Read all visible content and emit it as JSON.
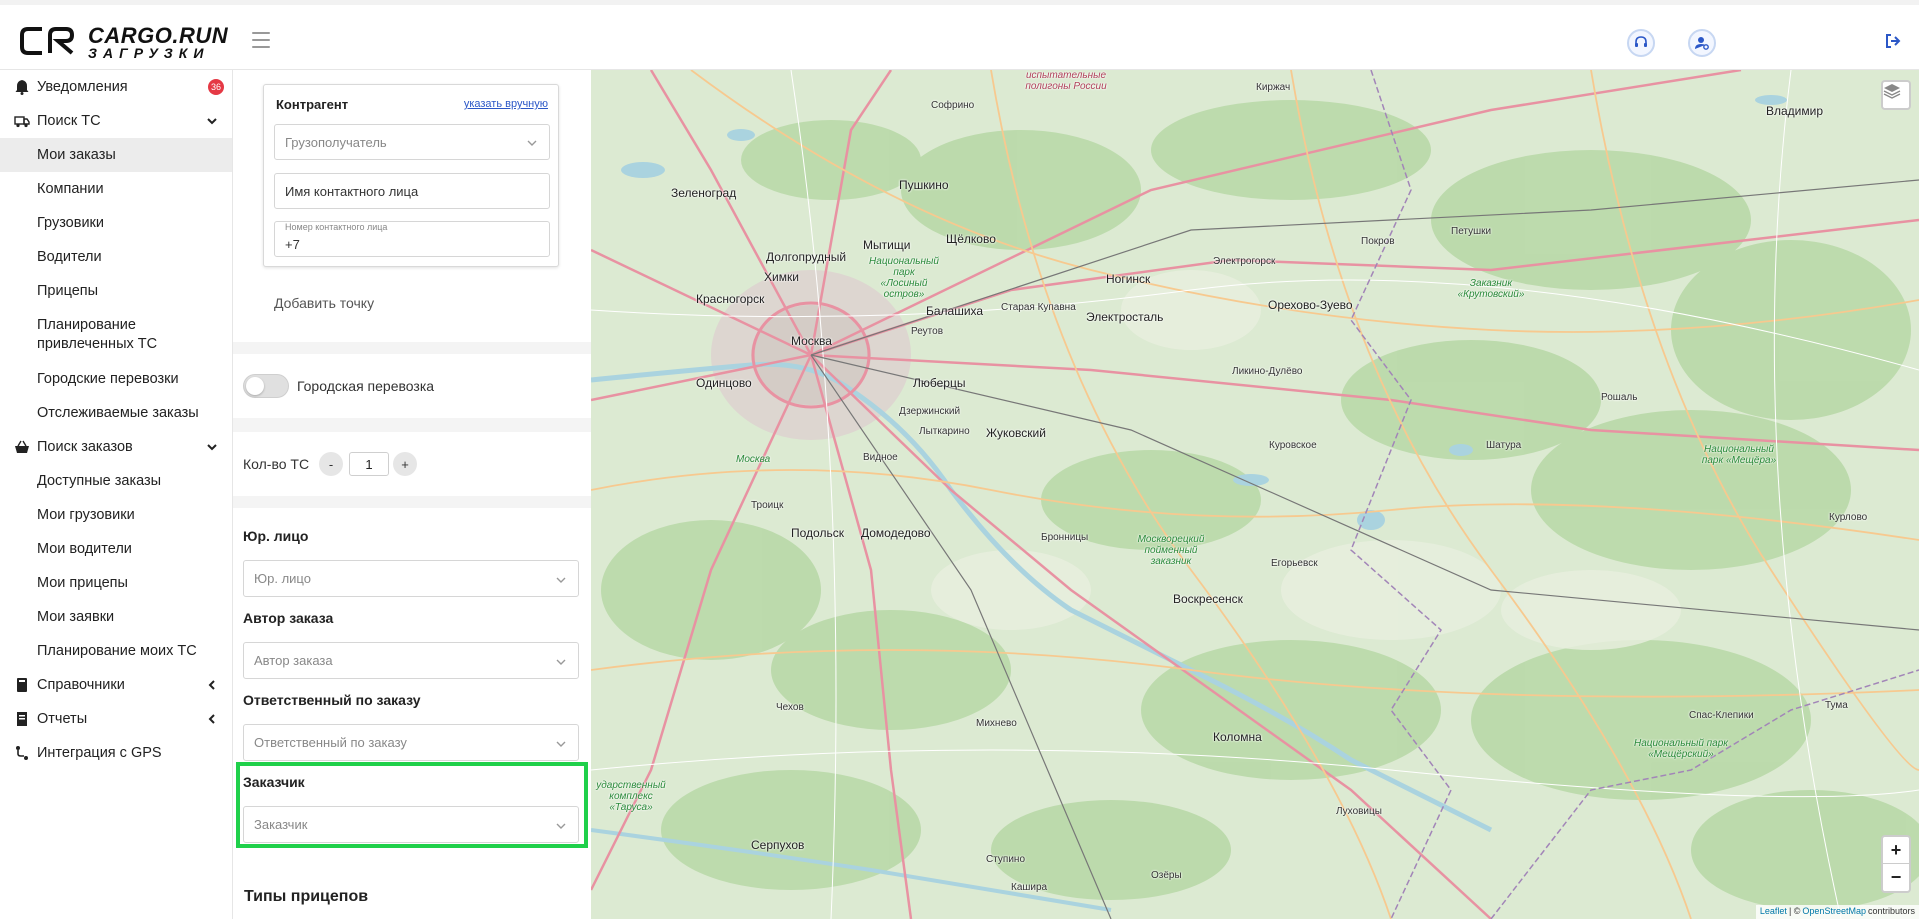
{
  "header": {
    "logo_line1": "CARGO.RUN",
    "logo_line2": "ЗАГРУЗКИ"
  },
  "sidebar": {
    "items": [
      {
        "label": "Уведомления",
        "icon": "bell-icon",
        "badge": "36"
      },
      {
        "label": "Поиск ТС",
        "icon": "truck-icon",
        "chevron": "down"
      },
      {
        "label": "Мои заказы",
        "active": true
      },
      {
        "label": "Компании"
      },
      {
        "label": "Грузовики"
      },
      {
        "label": "Водители"
      },
      {
        "label": "Прицепы"
      },
      {
        "label": "Планирование привлеченных ТС"
      },
      {
        "label": "Городские перевозки"
      },
      {
        "label": "Отслеживаемые заказы"
      },
      {
        "label": "Поиск заказов",
        "icon": "basket-icon",
        "chevron": "down"
      },
      {
        "label": "Доступные заказы"
      },
      {
        "label": "Мои грузовики"
      },
      {
        "label": "Мои водители"
      },
      {
        "label": "Мои прицепы"
      },
      {
        "label": "Мои заявки"
      },
      {
        "label": "Планирование моих ТС"
      },
      {
        "label": "Справочники",
        "icon": "book-icon",
        "chevron": "left"
      },
      {
        "label": "Отчеты",
        "icon": "report-icon",
        "chevron": "left"
      },
      {
        "label": "Интеграция с GPS",
        "icon": "gps-icon"
      }
    ]
  },
  "form": {
    "kontragent": {
      "title": "Контрагент",
      "link": "указать вручную",
      "type_placeholder": "Грузополучатель",
      "contact_name_placeholder": "Имя контактного лица",
      "contact_phone_label": "Номер контактного лица",
      "contact_phone_value": "+7"
    },
    "add_point": "Добавить точку",
    "city_transport_label": "Городская перевозка",
    "qty": {
      "label": "Кол-во ТС",
      "minus": "-",
      "value": "1",
      "plus": "+"
    },
    "legal_entity": {
      "label": "Юр. лицо",
      "placeholder": "Юр. лицо"
    },
    "author": {
      "label": "Автор заказа",
      "placeholder": "Автор заказа"
    },
    "responsible": {
      "label": "Ответственный по заказу",
      "placeholder": "Ответственный по заказу"
    },
    "customer": {
      "label": "Заказчик",
      "placeholder": "Заказчик"
    },
    "trailer_types_title": "Типы прицепов"
  },
  "map": {
    "labels": {
      "moscow": "Москва",
      "zelenograd": "Зеленоград",
      "khimki": "Химки",
      "pushkino": "Пушкино",
      "mytishchi": "Мытищи",
      "shchelkovo": "Щёлково",
      "balashikha": "Балашиха",
      "noginsk": "Ногинск",
      "elektrostal": "Электросталь",
      "orekhovo": "Орехово-Зуево",
      "lyubertsy": "Люберцы",
      "odintsovo": "Одинцово",
      "krasnogorsk": "Красногорск",
      "dolgoprudny": "Долгопрудный",
      "zhukovsky": "Жуковский",
      "podolsk": "Подольск",
      "domodedovo": "Домодедово",
      "voskresensk": "Воскресенск",
      "kolomna": "Коломна",
      "serpukhov": "Серпухов",
      "vladimir": "Владимир",
      "shatura": "Шатура",
      "troitsk": "Троицк",
      "vidnoe": "Видное",
      "lytkarino": "Лыткарино",
      "reutov": "Реутов",
      "kupavna": "Старая Купавна",
      "pokrov": "Покров",
      "petushki": "Петушки",
      "kurovskoe": "Куровское",
      "egorievsk": "Егорьевск",
      "chekhov": "Чехов",
      "mikhnevo": "Михнево",
      "ozery": "Озёры",
      "kashira": "Кашира",
      "stupino": "Ступино",
      "lukhovitsy": "Луховицы",
      "elektrogorsk": "Электрогорск",
      "kirzhach": "Киржач",
      "sofrino": "Софрино",
      "bronnitsy": "Бронницы",
      "roshal": "Рошаль",
      "kurlovo": "Курлово",
      "tuma": "Тума",
      "spas_klepiki": "Спас-Клепики",
      "likino": "Ликино-Дулёво",
      "dzerzhinsky": "Дзержинский",
      "park_losiny": "Национальный парк «Лосиный остров»",
      "zakaznik_krutovsky": "Заказник «Крутовский»",
      "park_meschera": "Национальный парк «Мещёра»",
      "park_meschersky": "Национальный парк «Мещёрский»",
      "zakaznik_moskvoretsky": "Москворецкий пойменный заказник",
      "moskva_river": "Москва",
      "polygons": "испытательные полигоны России",
      "tarusa": "ударственный комплекс «Таруса»"
    },
    "attribution": {
      "leaflet": "Leaflet",
      "sep": "| ©",
      "osm": "OpenStreetMap",
      "contrib": "contributors"
    },
    "zoom_in": "+",
    "zoom_out": "−"
  },
  "colors": {
    "highlight": "#1fd04a",
    "badge": "#e53945",
    "link": "#2b57c7"
  }
}
